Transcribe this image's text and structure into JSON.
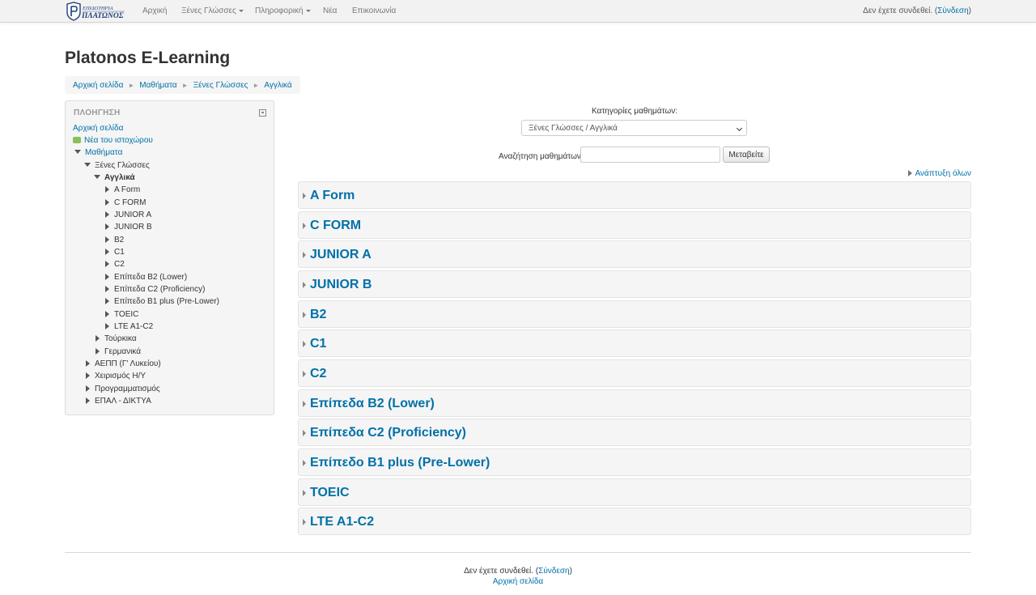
{
  "navbar": {
    "logo_text": "ΕΠΙΔΟΤΗΡΙΑ ΠΛΑΤΩΝΟΣ",
    "items": [
      {
        "label": "Αρχική",
        "dropdown": false
      },
      {
        "label": "Ξένες Γλώσσες",
        "dropdown": true
      },
      {
        "label": "Πληροφορική",
        "dropdown": true
      },
      {
        "label": "Νέα",
        "dropdown": false
      },
      {
        "label": "Επικοινωνία",
        "dropdown": false
      }
    ],
    "login_prefix": "Δεν έχετε συνδεθεί. (",
    "login_link": "Σύνδεση",
    "login_suffix": ")"
  },
  "page": {
    "title": "Platonos E-Learning",
    "breadcrumb": [
      "Αρχική σελίδα",
      "Μαθήματα",
      "Ξένες Γλώσσες",
      "Αγγλικά"
    ]
  },
  "navigation": {
    "title": "ΠΛΟΗΓΗΣΗ",
    "home": "Αρχική σελίδα",
    "site_news": "Νέα του ιστοχώρου",
    "courses": "Μαθήματα",
    "foreign_languages": "Ξένες Γλώσσες",
    "english": "Αγγλικά",
    "english_children": [
      "A Form",
      "C FORM",
      "JUNIOR A",
      "JUNIOR B",
      "B2",
      "C1",
      "C2",
      "Επίπεδα B2 (Lower)",
      "Επίπεδα C2 (Proficiency)",
      "Επίπεδο B1 plus (Pre-Lower)",
      "TOEIC",
      "LTE A1-C2"
    ],
    "languages_siblings": [
      "Τούρκικα",
      "Γερμανικά"
    ],
    "top_categories": [
      "ΑΕΠΠ (Γ' Λυκείου)",
      "Χειρισμός Η/Υ",
      "Προγραμματισμός",
      "ΕΠΑΛ - ΔΙΚΤΥΑ"
    ]
  },
  "main": {
    "categories_label": "Κατηγορίες μαθημάτων:",
    "categories_selected": "Ξένες Γλώσσες / Αγγλικά",
    "search_label": "Αναζήτηση μαθημάτων:",
    "search_value": "",
    "search_button": "Μεταβείτε",
    "expand_all": "Ανάπτυξη όλων",
    "courses": [
      "A Form",
      "C FORM",
      "JUNIOR A",
      "JUNIOR B",
      "B2",
      "C1",
      "C2",
      "Επίπεδα B2 (Lower)",
      "Επίπεδα C2 (Proficiency)",
      "Επίπεδο B1 plus (Pre-Lower)",
      "TOEIC",
      "LTE A1-C2"
    ]
  },
  "footer": {
    "login_prefix": "Δεν έχετε συνδεθεί. (",
    "login_link": "Σύνδεση",
    "login_suffix": ")",
    "home_link": "Αρχική σελίδα"
  },
  "colors": {
    "link": "#0070a8",
    "navbar_bg": "#f2f2f2",
    "block_bg": "#f5f5f5"
  }
}
